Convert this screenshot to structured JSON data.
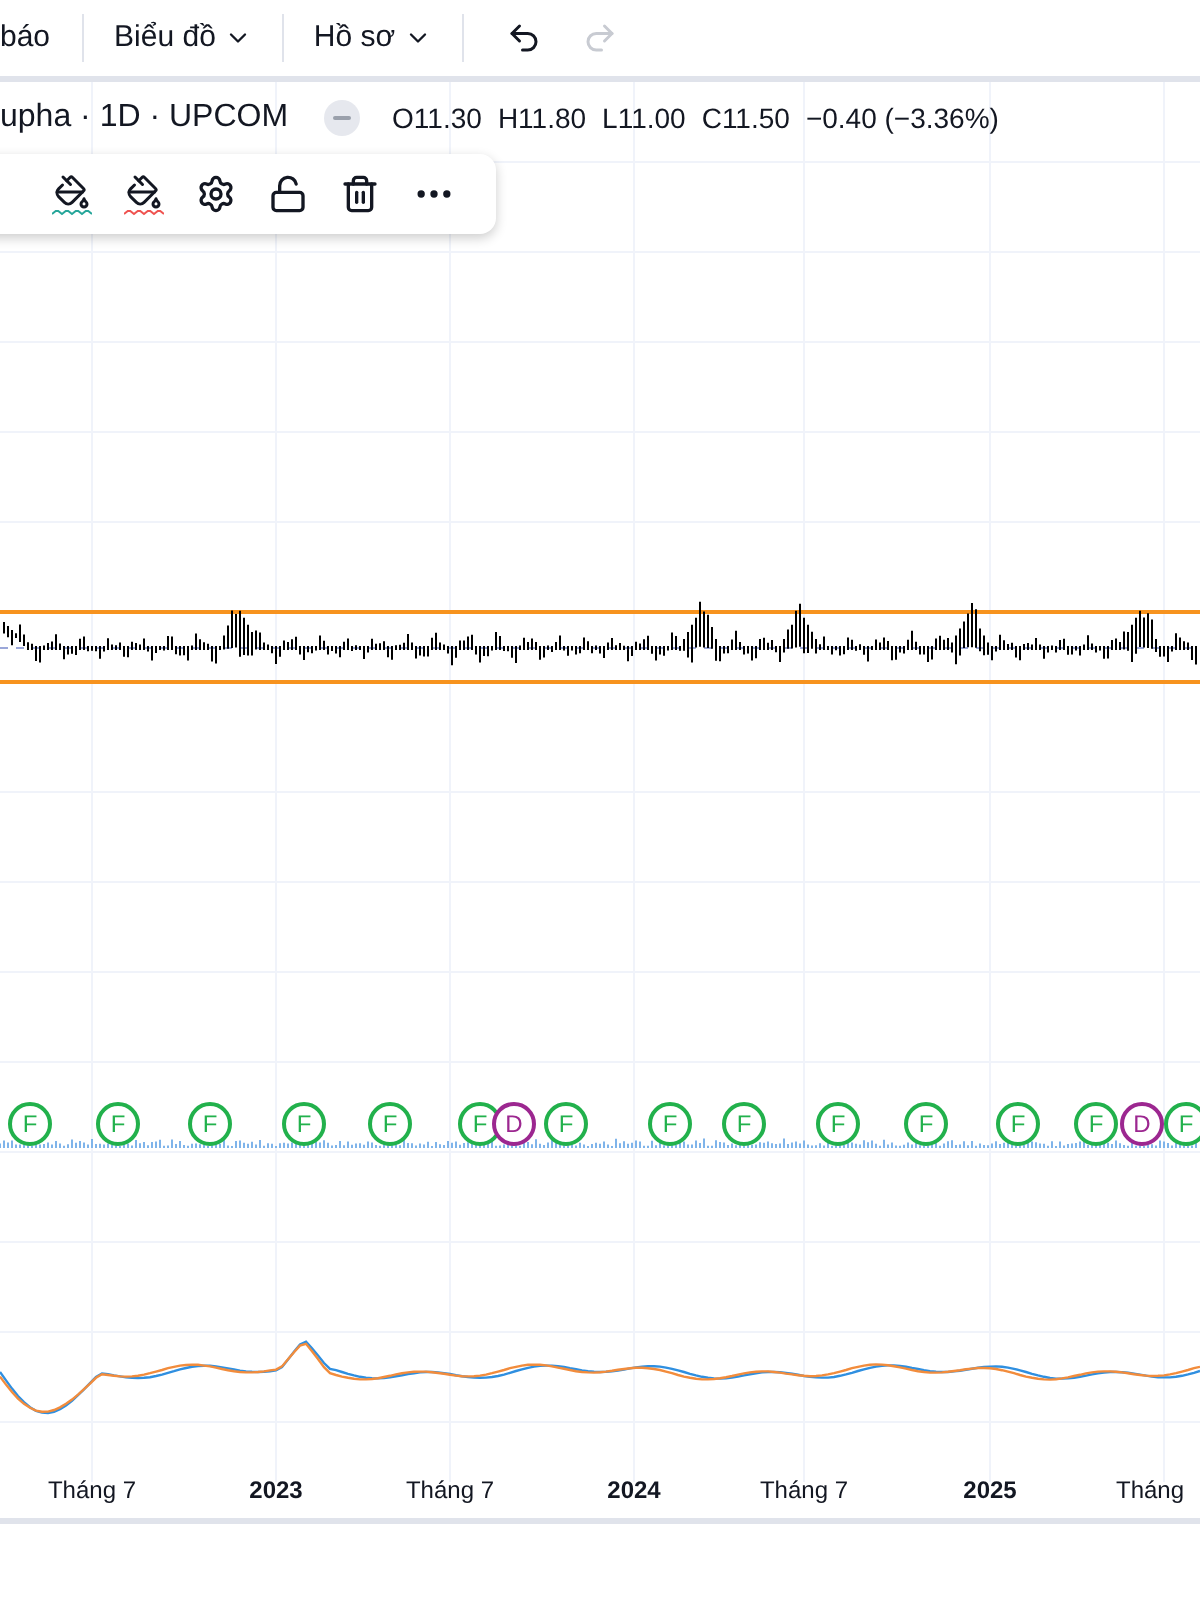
{
  "toolbar": {
    "items": [
      {
        "kind": "text",
        "label": "báo"
      },
      {
        "kind": "menu",
        "label": "Biểu đồ"
      },
      {
        "kind": "menu",
        "label": "Hồ sơ"
      }
    ],
    "undo": {
      "disabled": false
    },
    "redo": {
      "disabled": true
    }
  },
  "legend": {
    "symbol": "upha · 1D · UPCOM",
    "values": [
      "O11.30",
      "H11.80",
      "L11.00",
      "C11.50"
    ],
    "change": "−0.40 (−3.36%)"
  },
  "events": [
    {
      "label": "F",
      "color": "#22b14c"
    },
    {
      "label": "F",
      "color": "#22b14c"
    },
    {
      "label": "F",
      "color": "#22b14c"
    },
    {
      "label": "F",
      "color": "#22b14c"
    },
    {
      "label": "F",
      "color": "#22b14c"
    },
    {
      "label": "F",
      "color": "#22b14c"
    },
    {
      "label": "D",
      "color": "#9c2790"
    },
    {
      "label": "F",
      "color": "#22b14c"
    },
    {
      "label": "F",
      "color": "#22b14c"
    },
    {
      "label": "F",
      "color": "#22b14c"
    },
    {
      "label": "F",
      "color": "#22b14c"
    },
    {
      "label": "F",
      "color": "#22b14c"
    },
    {
      "label": "F",
      "color": "#22b14c"
    },
    {
      "label": "F",
      "color": "#22b14c"
    },
    {
      "label": "D",
      "color": "#9c2790"
    },
    {
      "label": "F",
      "color": "#22b14c"
    }
  ],
  "time_axis": {
    "labels": [
      {
        "kind": "month",
        "label": "Tháng 7"
      },
      {
        "kind": "year",
        "label": "2023"
      },
      {
        "kind": "month",
        "label": "Tháng 7"
      },
      {
        "kind": "year",
        "label": "2024"
      },
      {
        "kind": "month",
        "label": "Tháng 7"
      },
      {
        "kind": "year",
        "label": "2025"
      },
      {
        "kind": "month",
        "label": "Tháng"
      }
    ]
  }
}
